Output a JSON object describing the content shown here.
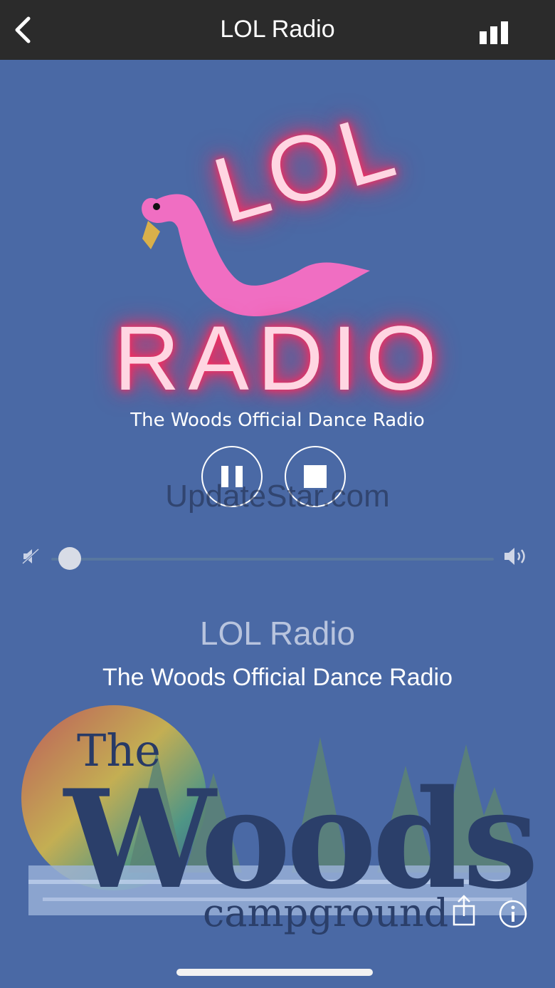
{
  "header": {
    "title": "LOL Radio",
    "back_icon": "chevron-left-icon",
    "signal_icon": "signal-bars-icon"
  },
  "logo": {
    "top_word": "LOL",
    "bottom_word": "RADIO"
  },
  "player": {
    "subtitle": "The Woods Official Dance Radio",
    "pause_icon": "pause-icon",
    "stop_icon": "stop-icon",
    "watermark": "UpdateStar.com",
    "volume_level": 0.02,
    "volume_min_icon": "volume-mute-icon",
    "volume_max_icon": "volume-loud-icon"
  },
  "station": {
    "name": "LOL Radio",
    "description": "The Woods Official Dance Radio"
  },
  "artwork": {
    "top_word": "The",
    "main_word": "Woods",
    "bottom_word": "campground"
  },
  "actions": {
    "share_icon": "share-icon",
    "info_icon": "info-icon"
  },
  "colors": {
    "background": "#4a69a5",
    "header": "#2b2b2b",
    "neon": "#ff2a5c",
    "flamingo": "#f06ec2"
  }
}
